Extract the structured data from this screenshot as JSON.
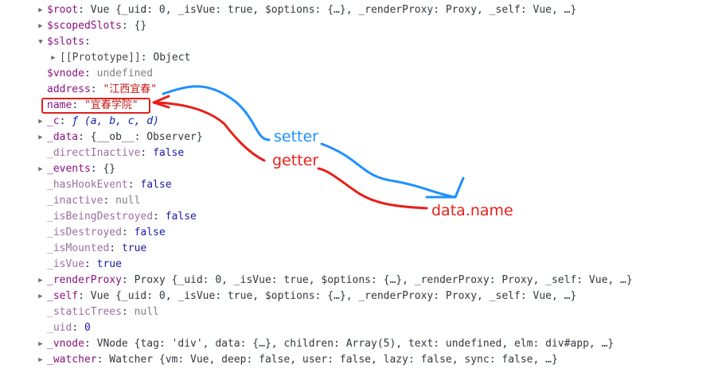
{
  "rows": [
    {
      "name": "$root",
      "expander": "right",
      "dim": false,
      "value_type": "text",
      "value": "Vue {_uid: 0, _isVue: true, $options: {…}, _renderProxy: Proxy, _self: Vue, …}"
    },
    {
      "name": "$scopedSlots",
      "expander": "right",
      "dim": false,
      "value_type": "text",
      "value": "{}"
    },
    {
      "name": "$slots",
      "expander": "down",
      "dim": false,
      "value_type": "text",
      "value": ""
    },
    {
      "name": "[[Prototype]]",
      "expander": "right",
      "dim": false,
      "indent": 1,
      "value_type": "text",
      "value": "Object"
    },
    {
      "name": "$vnode",
      "expander": "none",
      "dim": false,
      "value_type": "gray",
      "value": "undefined"
    },
    {
      "name": "address",
      "expander": "none",
      "dim": false,
      "value_type": "str",
      "value": "\"江西宜春\""
    },
    {
      "name": "name",
      "expander": "none",
      "dim": false,
      "value_type": "str",
      "value": "\"宜春学院\"",
      "highlight": true
    },
    {
      "name": "_c",
      "expander": "right",
      "dim": false,
      "value_type": "func",
      "value": "ƒ (a, b, c, d)"
    },
    {
      "name": "_data",
      "expander": "right",
      "dim": false,
      "value_type": "text",
      "value": "{__ob__: Observer}"
    },
    {
      "name": "_directInactive",
      "expander": "none",
      "dim": true,
      "value_type": "blue",
      "value": "false"
    },
    {
      "name": "_events",
      "expander": "right",
      "dim": false,
      "value_type": "text",
      "value": "{}"
    },
    {
      "name": "_hasHookEvent",
      "expander": "none",
      "dim": true,
      "value_type": "blue",
      "value": "false"
    },
    {
      "name": "_inactive",
      "expander": "none",
      "dim": true,
      "value_type": "gray",
      "value": "null"
    },
    {
      "name": "_isBeingDestroyed",
      "expander": "none",
      "dim": true,
      "value_type": "blue",
      "value": "false"
    },
    {
      "name": "_isDestroyed",
      "expander": "none",
      "dim": true,
      "value_type": "blue",
      "value": "false"
    },
    {
      "name": "_isMounted",
      "expander": "none",
      "dim": true,
      "value_type": "blue",
      "value": "true"
    },
    {
      "name": "_isVue",
      "expander": "none",
      "dim": true,
      "value_type": "blue",
      "value": "true"
    },
    {
      "name": "_renderProxy",
      "expander": "right",
      "dim": false,
      "value_type": "text",
      "value": "Proxy {_uid: 0, _isVue: true, $options: {…}, _renderProxy: Proxy, _self: Vue, …}"
    },
    {
      "name": "_self",
      "expander": "right",
      "dim": false,
      "value_type": "text",
      "value": "Vue {_uid: 0, _isVue: true, $options: {…}, _renderProxy: Proxy, _self: Vue, …}"
    },
    {
      "name": "_staticTrees",
      "expander": "none",
      "dim": true,
      "value_type": "gray",
      "value": "null"
    },
    {
      "name": "_uid",
      "expander": "none",
      "dim": true,
      "value_type": "blue",
      "value": "0"
    },
    {
      "name": "_vnode",
      "expander": "right",
      "dim": false,
      "value_type": "text",
      "value": "VNode {tag: 'div', data: {…}, children: Array(5), text: undefined, elm: div#app, …}"
    },
    {
      "name": "_watcher",
      "expander": "right",
      "dim": false,
      "value_type": "text",
      "value": "Watcher {vm: Vue, deep: false, user: false, lazy: false, sync: false, …}"
    }
  ],
  "annotations": {
    "setter": "setter",
    "getter": "getter",
    "target": "data.name"
  },
  "colors": {
    "key": "#881280",
    "string": "#c41a16",
    "keyword": "#1a1aa6",
    "setter_arrow": "#1e90ff",
    "getter_arrow": "#e8201a"
  }
}
